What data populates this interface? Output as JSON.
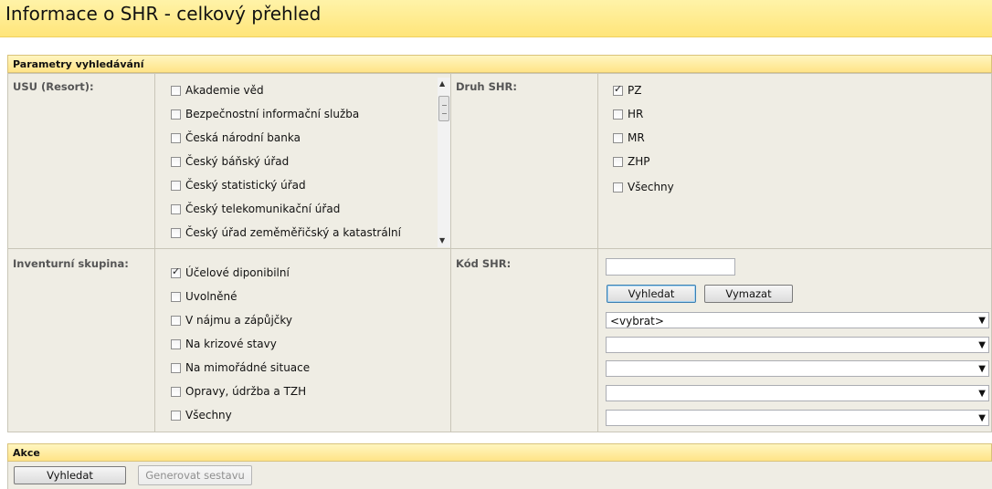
{
  "page": {
    "title": "Informace o SHR - celkový přehled"
  },
  "search_section": {
    "header": "Parametry vyhledávání"
  },
  "usu": {
    "label": "USU (Resort):",
    "items": [
      {
        "label": "Akademie věd",
        "checked": false
      },
      {
        "label": "Bezpečnostní informační služba",
        "checked": false
      },
      {
        "label": "Česká národní banka",
        "checked": false
      },
      {
        "label": "Český báňský úřad",
        "checked": false
      },
      {
        "label": "Český statistický úřad",
        "checked": false
      },
      {
        "label": "Český telekomunikační úřad",
        "checked": false
      },
      {
        "label": "Český úřad zeměměřičský a katastrální",
        "checked": false
      }
    ]
  },
  "druh": {
    "label": "Druh SHR:",
    "items": [
      {
        "label": "PZ",
        "checked": true
      },
      {
        "label": "HR",
        "checked": false
      },
      {
        "label": "MR",
        "checked": false
      },
      {
        "label": "ZHP",
        "checked": false
      },
      {
        "label": "Všechny",
        "checked": false
      }
    ]
  },
  "inventory": {
    "label": "Inventurní skupina:",
    "items": [
      {
        "label": "Účelové diponibilní",
        "checked": true
      },
      {
        "label": "Uvolněné",
        "checked": false
      },
      {
        "label": "V nájmu a zápůjčky",
        "checked": false
      },
      {
        "label": "Na krizové stavy",
        "checked": false
      },
      {
        "label": "Na mimořádné situace",
        "checked": false
      },
      {
        "label": "Opravy, údržba a TZH",
        "checked": false
      },
      {
        "label": "Všechny",
        "checked": false
      }
    ]
  },
  "kod": {
    "label": "Kód SHR:",
    "input_value": "",
    "search_button": "Vyhledat",
    "clear_button": "Vymazat",
    "selects": [
      "<vybrat>",
      "",
      "",
      "",
      ""
    ]
  },
  "actions": {
    "header": "Akce",
    "search_button": "Vyhledat",
    "generate_button": "Generovat sestavu"
  }
}
